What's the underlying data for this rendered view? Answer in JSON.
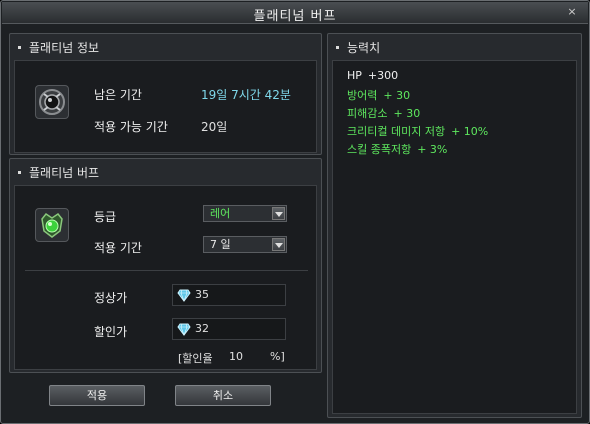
{
  "window": {
    "title": "플래티넘 버프",
    "close_glyph": "×"
  },
  "info_panel": {
    "header": "플래티넘 정보",
    "remaining_label": "남은 기간",
    "remaining_value": "19일 7시간 42분",
    "applicable_label": "적용 가능 기간",
    "applicable_value": "20일"
  },
  "buff_panel": {
    "header": "플래티넘 버프",
    "grade_label": "등급",
    "grade_value": "레어",
    "grade_color": "#5ee85e",
    "period_label": "적용 기간",
    "period_value": "7 일",
    "normal_price_label": "정상가",
    "normal_price_value": "35",
    "sale_price_label": "할인가",
    "sale_price_value": "32",
    "discount_label": "[할인율",
    "discount_value": "10",
    "discount_unit": "%]"
  },
  "buttons": {
    "apply": "적용",
    "cancel": "취소"
  },
  "stats_panel": {
    "header": "능력치",
    "lines": [
      {
        "name": "HP",
        "value": "+300",
        "color": "#f0f0f0"
      },
      {
        "name": "방어력",
        "value": "+ 30",
        "color": "#5ee85e"
      },
      {
        "name": "피해감소",
        "value": "+ 30",
        "color": "#5ee85e"
      },
      {
        "name": "크리티컬 데미지 저항",
        "value": "+ 10%",
        "color": "#5ee85e"
      },
      {
        "name": "스킬 종폭저항",
        "value": "+  3%",
        "color": "#5ee85e"
      }
    ]
  },
  "icons": {
    "info_icon": "dark-emblem-icon",
    "buff_icon": "green-gem-emblem-icon",
    "currency_icon": "diamond-icon"
  }
}
